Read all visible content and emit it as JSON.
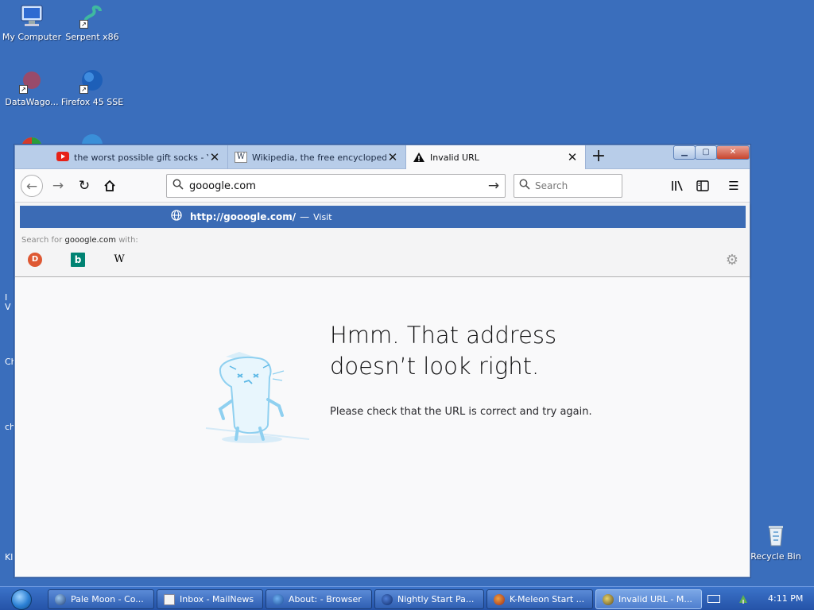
{
  "desktop": {
    "icons": [
      {
        "label": "My Computer"
      },
      {
        "label": "Serpent x86"
      },
      {
        "label": "DataWago..."
      },
      {
        "label": "Firefox 45 SSE"
      },
      {
        "label": "Recycle Bin"
      }
    ],
    "edge_fragments": [
      "I",
      "V",
      "Ch",
      "ch",
      "Kl"
    ]
  },
  "browser": {
    "tabs": [
      {
        "title": "the worst possible gift socks - Y",
        "favicon": "youtube-icon",
        "active": false
      },
      {
        "title": "Wikipedia, the free encyclopedi",
        "favicon": "wikipedia-icon",
        "active": false
      },
      {
        "title": "Invalid URL",
        "favicon": "warning-icon",
        "active": true
      }
    ],
    "new_tab_label": "+",
    "address": {
      "value": "gooogle.com"
    },
    "search": {
      "placeholder": "Search"
    },
    "popup": {
      "suggestion_url": "http://gooogle.com/",
      "suggestion_separator": "—",
      "suggestion_action": "Visit",
      "search_for_prefix": "Search for",
      "search_for_term": "gooogle.com",
      "search_for_suffix": "with:",
      "engines": [
        {
          "name": "DuckDuckGo",
          "glyph": "D"
        },
        {
          "name": "Bing",
          "glyph": "b"
        },
        {
          "name": "Wikipedia",
          "glyph": "W"
        }
      ]
    },
    "error": {
      "title_line1": "Hmm. That address",
      "title_line2": "doesn’t look right.",
      "description": "Please check that the URL is correct and try again."
    }
  },
  "taskbar": {
    "buttons": [
      {
        "label": "Pale Moon - Co...",
        "active": false
      },
      {
        "label": "Inbox - MailNews",
        "active": false
      },
      {
        "label": "About: - Browser",
        "active": false
      },
      {
        "label": "Nightly Start Pa...",
        "active": false
      },
      {
        "label": "K-Meleon Start ...",
        "active": false
      },
      {
        "label": "Invalid URL - M...",
        "active": true
      }
    ],
    "clock": "4:11 PM"
  },
  "colors": {
    "desktop": "#3a6ebc",
    "suggestion_highlight": "#3b6bb5",
    "tabstrip": "#b8cde9"
  }
}
